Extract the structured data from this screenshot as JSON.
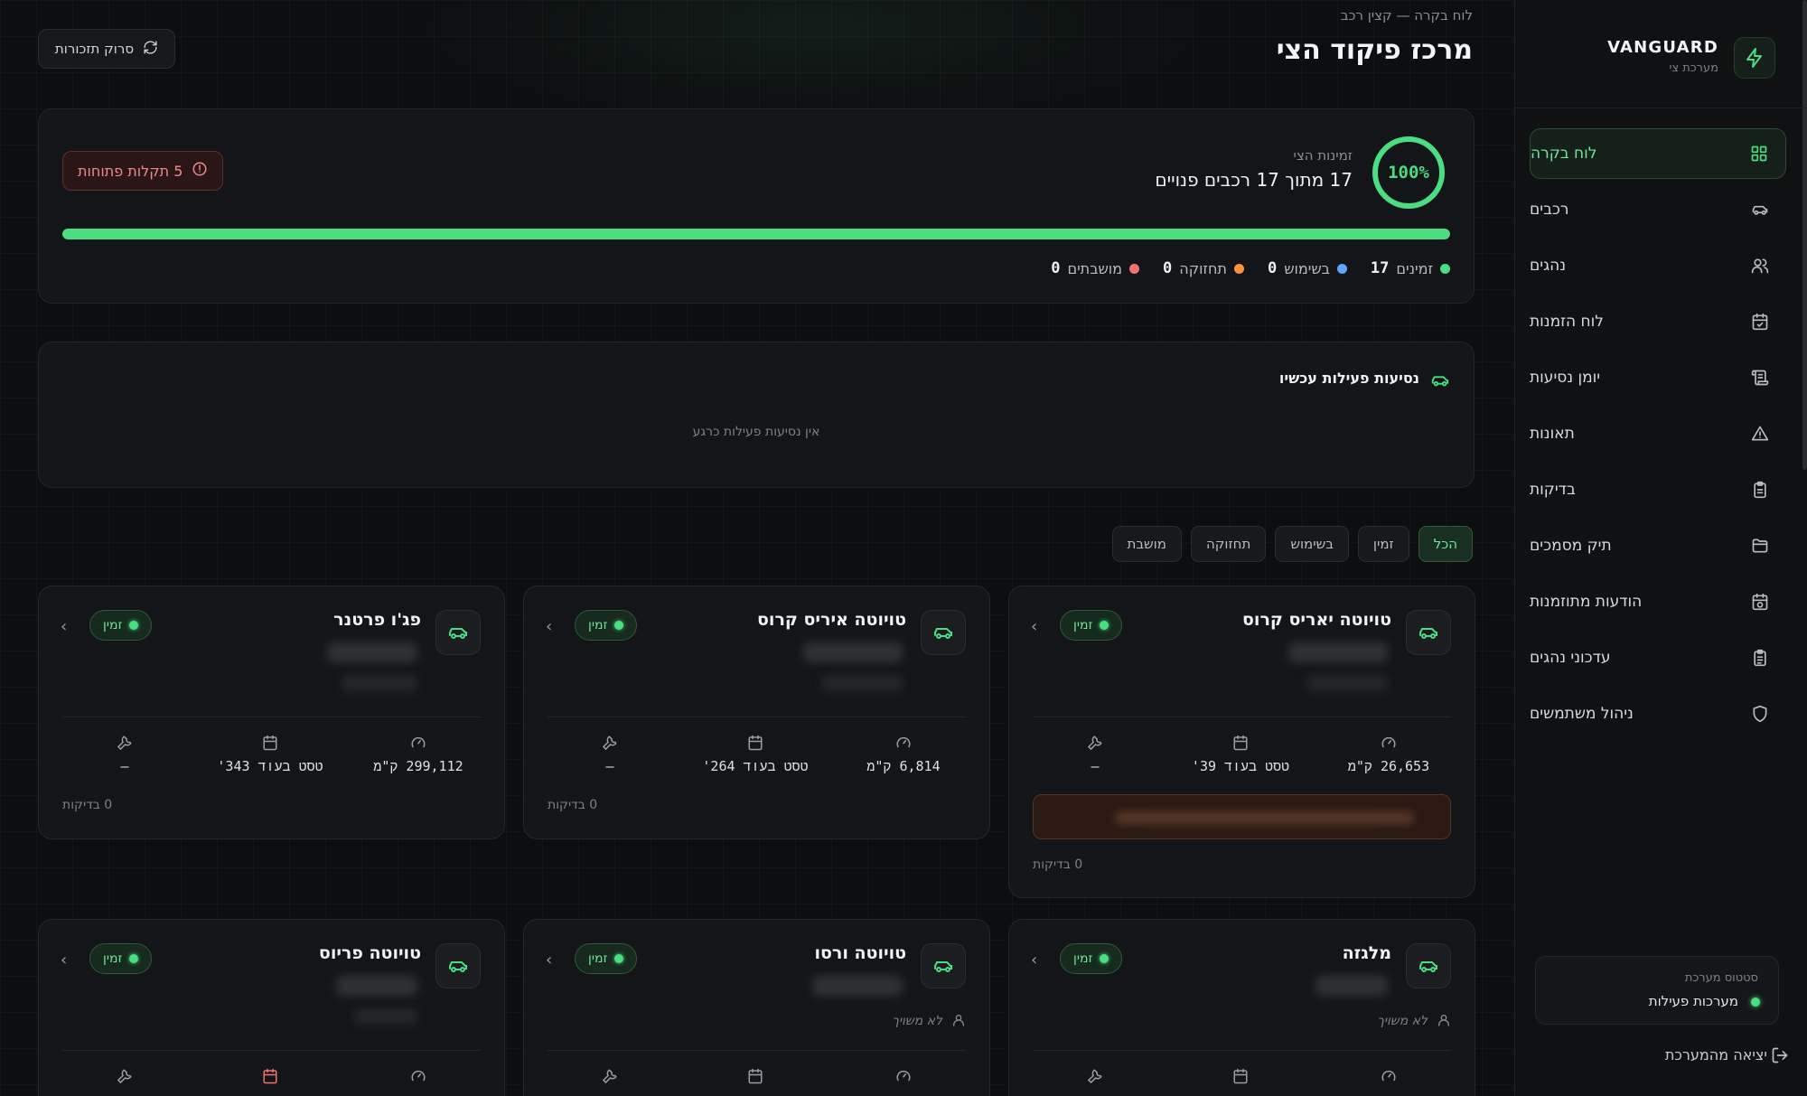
{
  "sidebar": {
    "brand": {
      "title": "VANGUARD",
      "subtitle": "מערכת צי"
    },
    "items": [
      {
        "label": "לוח בקרה",
        "icon": "grid-icon",
        "active": true
      },
      {
        "label": "רכבים",
        "icon": "car-icon"
      },
      {
        "label": "נהגים",
        "icon": "users-icon"
      },
      {
        "label": "לוח הזמנות",
        "icon": "calendar-check-icon"
      },
      {
        "label": "יומן נסיעות",
        "icon": "scroll-icon"
      },
      {
        "label": "תאונות",
        "icon": "warning-icon"
      },
      {
        "label": "בדיקות",
        "icon": "clipboard-icon"
      },
      {
        "label": "תיק מסמכים",
        "icon": "folder-icon"
      },
      {
        "label": "הודעות מתוזמנות",
        "icon": "calendar-clock-icon"
      },
      {
        "label": "עדכוני נהגים",
        "icon": "clipboard-list-icon"
      },
      {
        "label": "ניהול משתמשים",
        "icon": "shield-icon"
      }
    ],
    "system": {
      "title": "סטטוס מערכת",
      "status": "מערכות פעילות"
    },
    "logout": "יציאה מהמערכת"
  },
  "header": {
    "breadcrumb": "לוח בקרה — קצין רכב",
    "title": "מרכז פיקוד הצי",
    "sync_label": "סרוק תזכורות"
  },
  "readiness": {
    "percent_label": "100%",
    "percent": 100,
    "label": "זמינות הצי",
    "value": "17 מתוך 17 רכבים פנויים",
    "faults": "5 תקלות פתוחות",
    "legend": [
      {
        "label": "זמינים",
        "value": "17",
        "color": "#4ade80"
      },
      {
        "label": "בשימוש",
        "value": "0",
        "color": "#60a5fa"
      },
      {
        "label": "תחזוקה",
        "value": "0",
        "color": "#fb923c"
      },
      {
        "label": "מושבתים",
        "value": "0",
        "color": "#f87171"
      }
    ]
  },
  "active_trips": {
    "title": "נסיעות פעילות עכשיו",
    "empty": "אין נסיעות פעילות כרגע"
  },
  "filters": [
    "הכל",
    "זמין",
    "בשימוש",
    "תחזוקה",
    "מושבת"
  ],
  "vehicles": [
    {
      "name": "טויוטה יאריס קרוס",
      "status": "זמין",
      "km": "26,653 ק\"מ",
      "test": "טסט בעוד 39'",
      "maint": "–",
      "checks": "0 בדיקות"
    },
    {
      "name": "טויוטה איריס קרוס",
      "status": "זמין",
      "km": "6,814 ק\"מ",
      "test": "טסט בעוד 264'",
      "maint": "–",
      "checks": "0 בדיקות"
    },
    {
      "name": "פג'ו פרטנר",
      "status": "זמין",
      "km": "299,112 ק\"מ",
      "test": "טסט בעוד 343'",
      "maint": "–",
      "checks": "0 בדיקות"
    },
    {
      "name": "מלגזה",
      "status": "זמין",
      "driver": "לא משויך"
    },
    {
      "name": "טויוטה ורסו",
      "status": "זמין",
      "driver": "לא משויך"
    },
    {
      "name": "טויוטה פריוס",
      "status": "זמין"
    }
  ]
}
